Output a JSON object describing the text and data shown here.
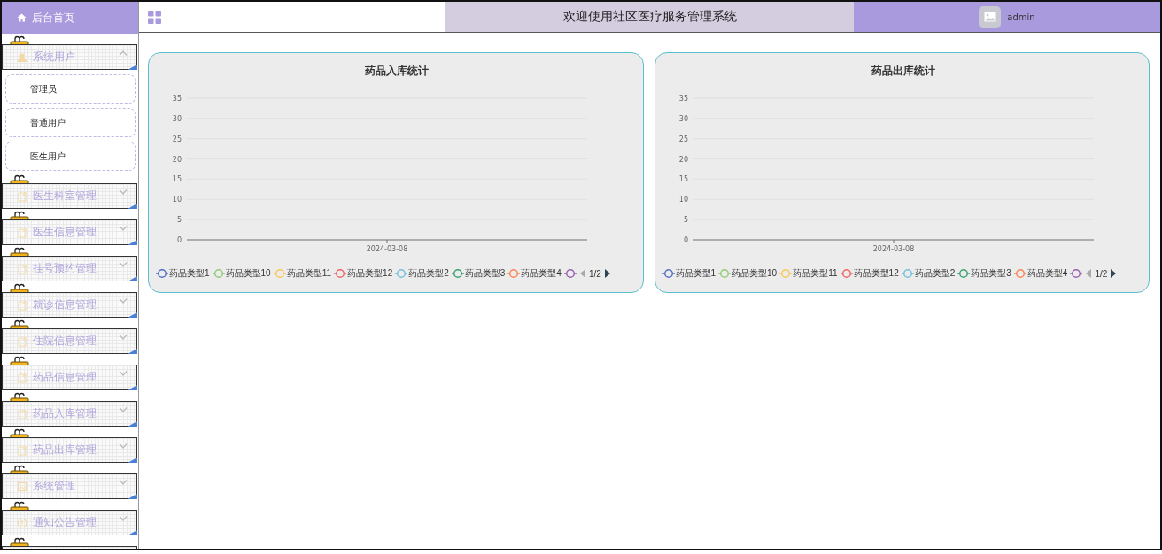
{
  "sidebar": {
    "home": {
      "label": "后台首页"
    },
    "items": [
      {
        "label": "系统用户",
        "kind": "user",
        "expanded": true,
        "children": [
          {
            "label": "管理员"
          },
          {
            "label": "普通用户"
          },
          {
            "label": "医生用户"
          }
        ]
      },
      {
        "label": "医生科室管理",
        "kind": "page",
        "expanded": false
      },
      {
        "label": "医生信息管理",
        "kind": "page",
        "expanded": false
      },
      {
        "label": "挂号预约管理",
        "kind": "page",
        "expanded": false
      },
      {
        "label": "就诊信息管理",
        "kind": "page",
        "expanded": false
      },
      {
        "label": "住院信息管理",
        "kind": "page",
        "expanded": false
      },
      {
        "label": "药品信息管理",
        "kind": "page",
        "expanded": false
      },
      {
        "label": "药品入库管理",
        "kind": "page",
        "expanded": false
      },
      {
        "label": "药品出库管理",
        "kind": "page",
        "expanded": false
      },
      {
        "label": "系统管理",
        "kind": "image",
        "expanded": false
      },
      {
        "label": "通知公告管理",
        "kind": "info",
        "expanded": false
      }
    ]
  },
  "header": {
    "title": "欢迎使用社区医疗服务管理系统",
    "user": "admin"
  },
  "charts": [
    {
      "chart_data": {
        "type": "line",
        "grid": true,
        "title": "药品入库统计",
        "categories": [
          "2024-03-08"
        ],
        "yticks": [
          0,
          5,
          10,
          15,
          20,
          25,
          30,
          35
        ],
        "ylim": [
          0,
          35
        ],
        "series": [
          {
            "name": "药品类型1",
            "color": "#5470c6",
            "values": [
              null
            ]
          },
          {
            "name": "药品类型10",
            "color": "#91cc75",
            "values": [
              null
            ]
          },
          {
            "name": "药品类型11",
            "color": "#fac858",
            "values": [
              null
            ]
          },
          {
            "name": "药品类型12",
            "color": "#ee6666",
            "values": [
              null
            ]
          },
          {
            "name": "药品类型2",
            "color": "#73c0de",
            "values": [
              null
            ]
          },
          {
            "name": "药品类型3",
            "color": "#3ba272",
            "values": [
              null
            ]
          },
          {
            "name": "药品类型4",
            "color": "#fc8452",
            "values": [
              null
            ]
          },
          {
            "color": "#9a60b4",
            "values": [
              null
            ]
          }
        ]
      },
      "legend_pager": {
        "text": "1/2",
        "prev_disabled": true,
        "next_disabled": false
      }
    },
    {
      "chart_data": {
        "type": "line",
        "grid": true,
        "title": "药品出库统计",
        "categories": [
          "2024-03-08"
        ],
        "yticks": [
          0,
          5,
          10,
          15,
          20,
          25,
          30,
          35
        ],
        "ylim": [
          0,
          35
        ],
        "series": [
          {
            "name": "药品类型1",
            "color": "#5470c6",
            "values": [
              null
            ]
          },
          {
            "name": "药品类型10",
            "color": "#91cc75",
            "values": [
              null
            ]
          },
          {
            "name": "药品类型11",
            "color": "#fac858",
            "values": [
              null
            ]
          },
          {
            "name": "药品类型12",
            "color": "#ee6666",
            "values": [
              null
            ]
          },
          {
            "name": "药品类型2",
            "color": "#73c0de",
            "values": [
              null
            ]
          },
          {
            "name": "药品类型3",
            "color": "#3ba272",
            "values": [
              null
            ]
          },
          {
            "name": "药品类型4",
            "color": "#fc8452",
            "values": [
              null
            ]
          },
          {
            "color": "#9a60b4",
            "values": [
              null
            ]
          }
        ]
      },
      "legend_pager": {
        "text": "1/2",
        "prev_disabled": true,
        "next_disabled": false
      }
    }
  ]
}
